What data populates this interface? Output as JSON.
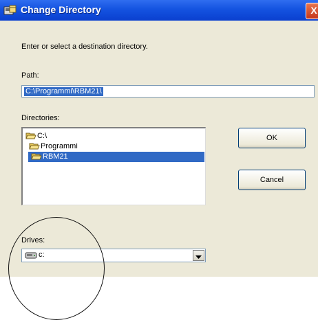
{
  "window": {
    "title": "Change Directory",
    "close_glyph": "X"
  },
  "main": {
    "instruction": "Enter or select a destination directory.",
    "path_label": "Path:",
    "path_value": "C:\\Programmi\\RBM21\\",
    "directories_label": "Directories:",
    "directories": [
      {
        "label": "C:\\",
        "icon": "open-folder-icon",
        "selected": false
      },
      {
        "label": "Programmi",
        "icon": "open-folder-icon",
        "selected": false
      },
      {
        "label": "RBM21",
        "icon": "open-folder-icon",
        "selected": true
      }
    ],
    "drives_label": "Drives:",
    "drive_value": "c:"
  },
  "buttons": {
    "ok": "OK",
    "cancel": "Cancel"
  },
  "colors": {
    "title_bar": "#1453e0",
    "selection": "#316ac5",
    "face": "#ece9d8"
  }
}
